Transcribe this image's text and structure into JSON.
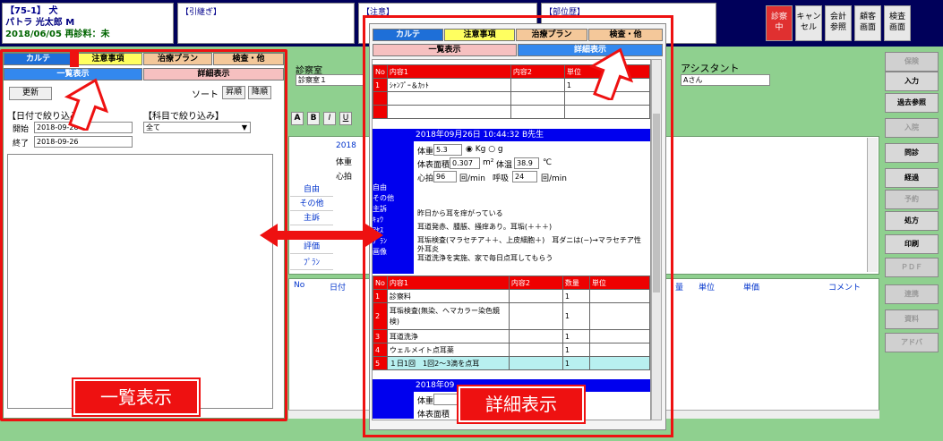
{
  "header": {
    "patient_id": "【75-1】 犬",
    "patient_name": "パトラ 光太郎 M",
    "visit_info": "2018/06/05 再診料：未",
    "box_history": "【引継ぎ】",
    "box_caution": "【注意】",
    "box_address": "【部位歴】",
    "buttons": {
      "in_exam": "診察\n中",
      "cancel": "キャン\nセル",
      "accounting": "会計\n参照",
      "customer": "顧客\n画面",
      "exam_screen": "検査\n画面"
    }
  },
  "left_panel": {
    "tabs": [
      "カルテ",
      "注意事項",
      "治療プラン",
      "検査・他"
    ],
    "subtabs": [
      "一覧表示",
      "詳細表示"
    ],
    "update_label": "更新",
    "sort_label": "ソート",
    "asc_label": "昇順",
    "desc_label": "降順",
    "date_filter_label": "【日付で絞り込み】",
    "subject_filter_label": "【科目で絞り込み】",
    "start_label": "開始",
    "start_value": "2018-09-26",
    "end_label": "終了",
    "end_value": "2018-09-26",
    "subject_value": "全て"
  },
  "center_panel": {
    "clinic_label": "診察室",
    "clinic_value": "診察室１",
    "assistant_label": "アシスタント",
    "assistant_value": "Aさん",
    "toolbar": [
      "A",
      "B",
      "I",
      "U"
    ],
    "date_fragment": "2018",
    "weight_fragment": "体重",
    "heart_fragment": "心拍",
    "row_labels": [
      "自由",
      "その他",
      "主訴",
      "評価",
      "ﾌﾟﾗﾝ"
    ],
    "lower_headers": [
      "No",
      "日付"
    ],
    "right_headers": [
      "量",
      "単位",
      "単価",
      "コメント"
    ]
  },
  "detail_popup": {
    "tabs": [
      "カルテ",
      "注意事項",
      "治療プラン",
      "検査・他"
    ],
    "subtabs": [
      "一覧表示",
      "詳細表示"
    ],
    "top_table": {
      "headers": [
        "No",
        "内容1",
        "内容2",
        "単位"
      ],
      "rows": [
        {
          "no": "1",
          "c1": "ｼｬﾝﾌﾟｰ＆ｶｯﾄ",
          "c2": "",
          "unit": "1"
        },
        {
          "no": "",
          "c1": "",
          "c2": "",
          "unit": ""
        },
        {
          "no": "",
          "c1": "",
          "c2": "",
          "unit": ""
        }
      ]
    },
    "record": {
      "title": "2018年09月26日 10:44:32 B先生",
      "weight_label": "体重",
      "weight_value": "5.3",
      "weight_unit": "◉ Kg ○ g",
      "bsa_label": "体表面積",
      "bsa_value": "0.307",
      "bsa_unit": "m²",
      "temp_label": "体温",
      "temp_value": "38.9",
      "temp_unit": "℃",
      "hr_label": "心拍",
      "hr_value": "96",
      "hr_unit": "回/min",
      "resp_label": "呼吸",
      "resp_value": "24",
      "resp_unit": "回/min",
      "side_labels": [
        "自由",
        "その他",
        "主訴",
        "ｷｮｳ",
        "ｱｾｽ",
        "ﾌﾟﾗﾝ",
        "画像"
      ],
      "complaint": "昨日から耳を痒がっている",
      "finding": "耳道発赤、腫脹、掻痒あり。耳垢(＋＋＋)",
      "assessment1": "耳垢検査(マラセチア＋＋、上皮細胞＋)　耳ダニは(−)→マラセチア性外耳炎",
      "plan": "耳道洗浄を実施、家で毎日点耳してもらう"
    },
    "bottom_table": {
      "headers": [
        "No",
        "内容1",
        "内容2",
        "数量",
        "単位"
      ],
      "rows": [
        {
          "no": "1",
          "c1": "診察料",
          "c2": "",
          "qty": "1",
          "unit": ""
        },
        {
          "no": "2",
          "c1": "耳垢検査(無染、ヘマカラー染色鏡検)",
          "c2": "",
          "qty": "1",
          "unit": ""
        },
        {
          "no": "3",
          "c1": "耳道洗浄",
          "c2": "",
          "qty": "1",
          "unit": ""
        },
        {
          "no": "4",
          "c1": "ウェルメイト点耳薬",
          "c2": "",
          "qty": "1",
          "unit": ""
        },
        {
          "no": "5",
          "c1": "１日1回　1回2〜3滴を点耳",
          "c2": "",
          "qty": "1",
          "unit": ""
        }
      ]
    },
    "next_record_title": "2018年09",
    "next_weight_label": "体重",
    "next_bsa_label": "体表面積"
  },
  "side_buttons": [
    {
      "label": "保険",
      "dim": true
    },
    {
      "label": "入力",
      "dim": false
    },
    {
      "label": "過去参照",
      "dim": false
    },
    {
      "label": "入院",
      "dim": true
    },
    {
      "label": "問診",
      "dim": false
    },
    {
      "label": "経過",
      "dim": false
    },
    {
      "label": "予約",
      "dim": true
    },
    {
      "label": "処方",
      "dim": false
    },
    {
      "label": "印刷",
      "dim": false
    },
    {
      "label": "ＰＤＦ",
      "dim": true
    },
    {
      "label": "連携",
      "dim": true
    },
    {
      "label": "資料",
      "dim": true
    },
    {
      "label": "アドバ",
      "dim": true
    }
  ],
  "overlays": {
    "left_label": "一覧表示",
    "right_label": "詳細表示"
  }
}
